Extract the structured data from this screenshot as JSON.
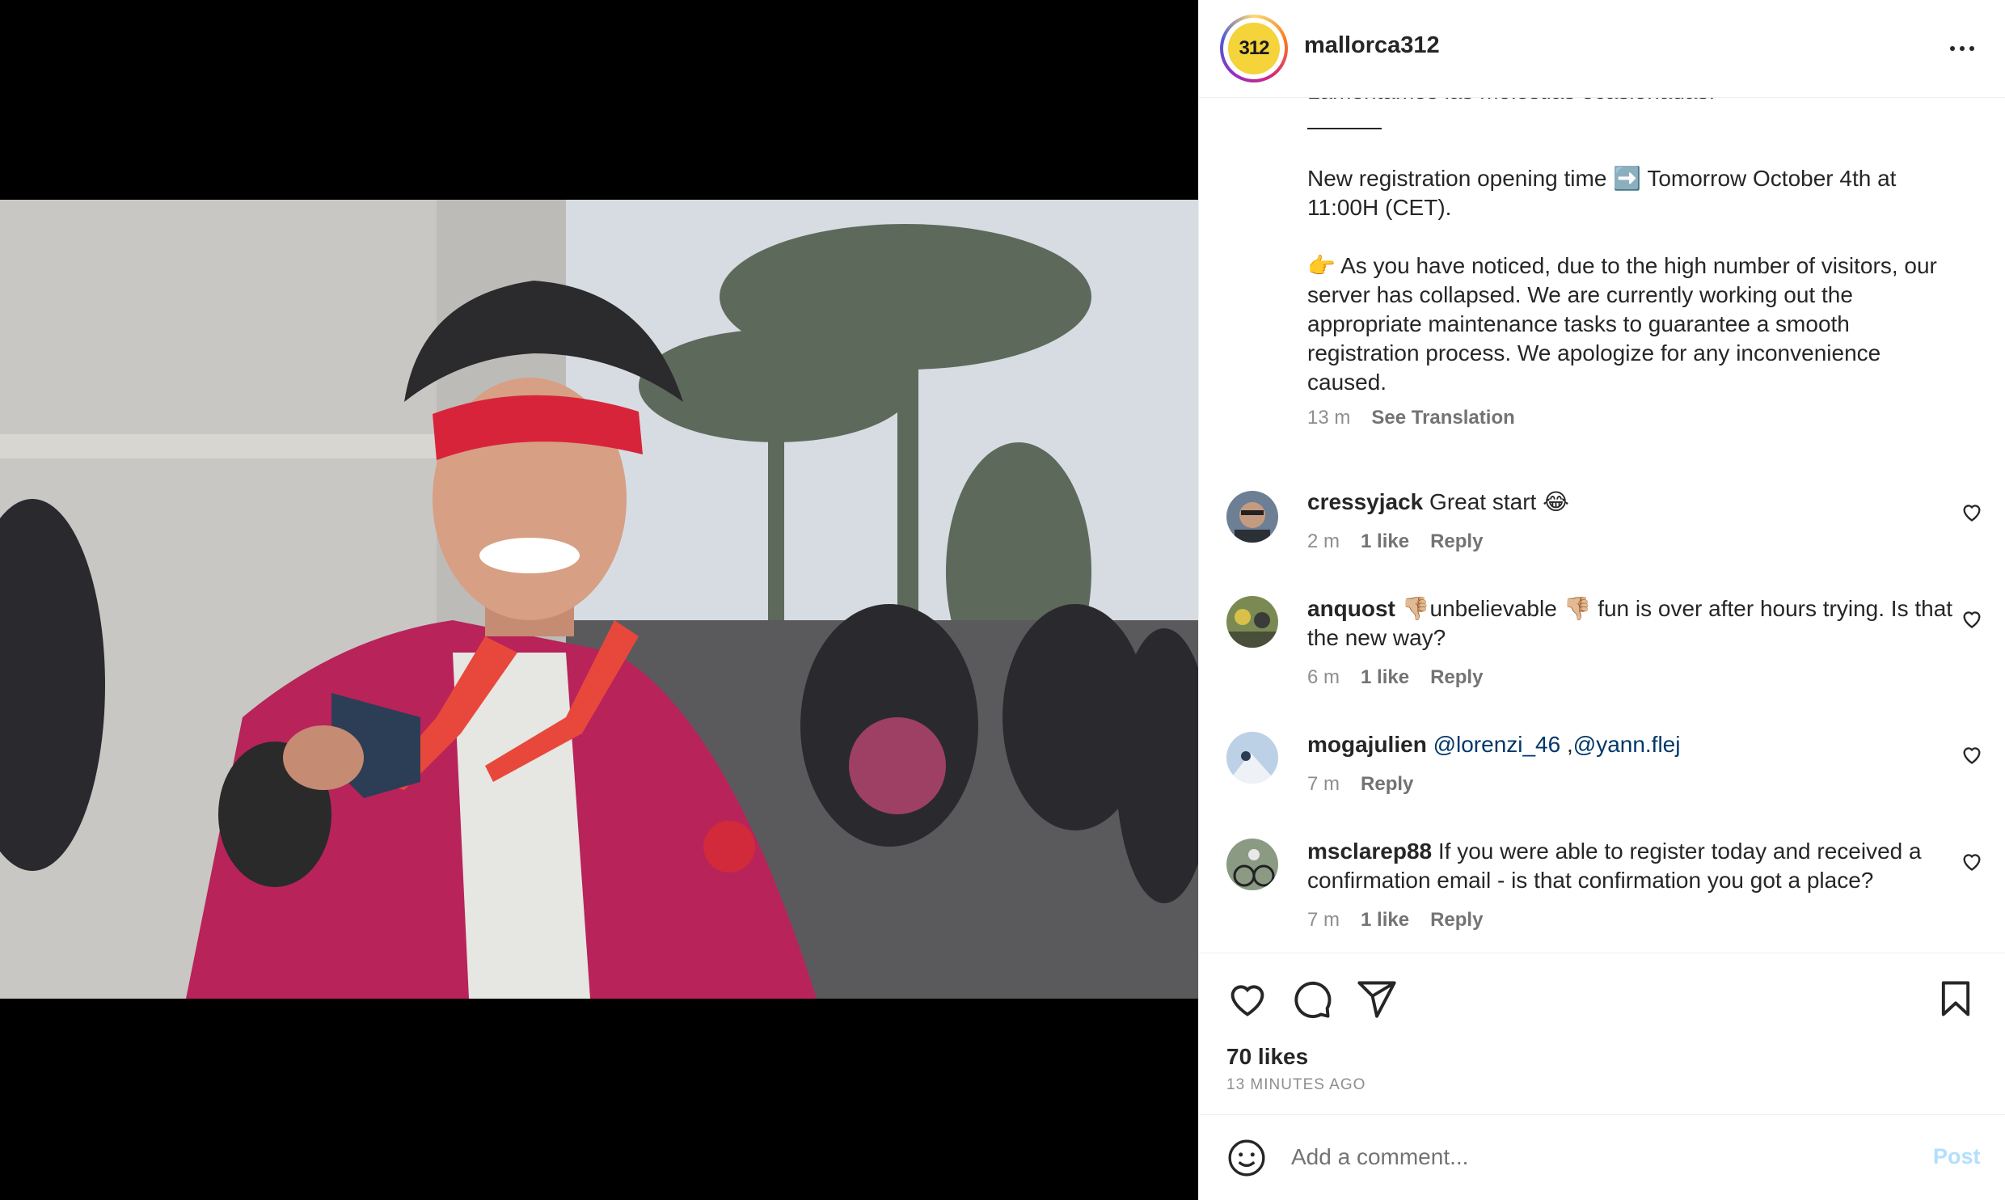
{
  "post": {
    "username": "mallorca312",
    "avatar_text": "312",
    "caption_clipped": "Lamentamos las molestias ocasionadas.",
    "caption": "New registration opening time ➡️ Tomorrow October 4th at 11:00H (CET).\n\n👉 As you have noticed, due to the high number of visitors, our server has collapsed. We are currently working out the appropriate maintenance tasks to guarantee a smooth registration process. We apologize for any inconvenience caused.",
    "caption_time": "13 m",
    "see_translation": "See Translation",
    "likes": "70 likes",
    "time_ago": "13 MINUTES AGO"
  },
  "comments": [
    {
      "user": "cressyjack",
      "text": " Great start 😂",
      "time": "2 m",
      "likes": "1 like",
      "reply": "Reply"
    },
    {
      "user": "anquost",
      "text": " 👎🏼unbelievable 👎🏼 fun is over after hours trying. Is that the new way?",
      "time": "6 m",
      "likes": "1 like",
      "reply": "Reply"
    },
    {
      "user": "mogajulien",
      "mention1": "@lorenzi_46",
      "sep": " ,",
      "mention2": "@yann.flej",
      "time": "7 m",
      "reply": "Reply"
    },
    {
      "user": "msclarep88",
      "text": " If you were able to register today and received a confirmation email - is that confirmation you got a place?",
      "time": "7 m",
      "likes": "1 like",
      "reply": "Reply"
    }
  ],
  "add_comment": {
    "placeholder": "Add a comment...",
    "post_label": "Post"
  },
  "icons": {
    "more": "more-options-icon",
    "like": "heart-icon",
    "comment": "comment-icon",
    "share": "share-icon",
    "save": "bookmark-icon",
    "emoji": "emoji-icon"
  },
  "colors": {
    "link": "#00376b",
    "muted": "#8e8e8e",
    "post_disabled": "#b2dffc"
  }
}
